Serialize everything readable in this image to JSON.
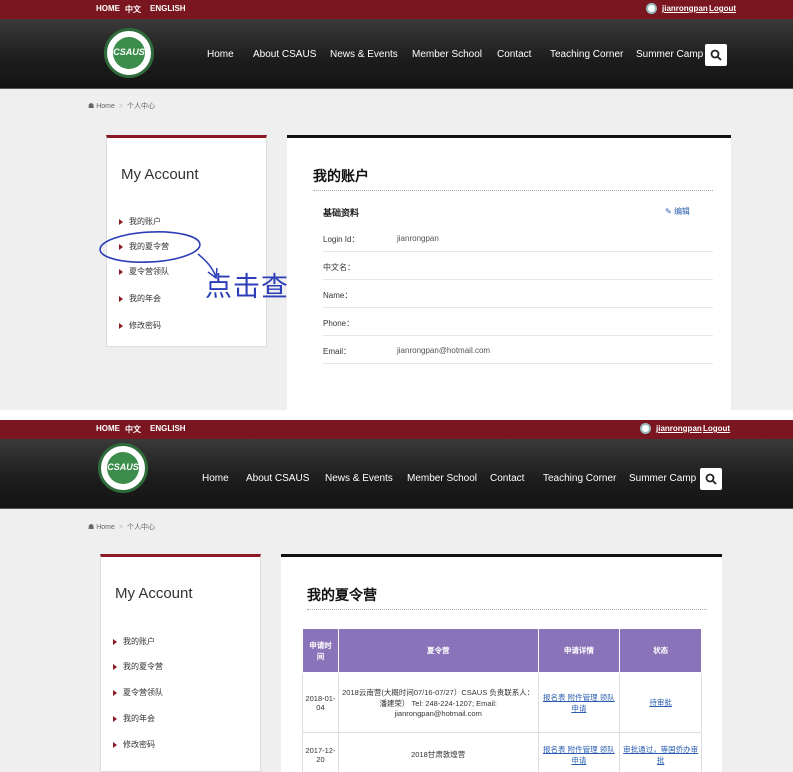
{
  "topbar": {
    "lang_home": "HOME",
    "lang_zh": "中文",
    "lang_en": "ENGLISH",
    "username": "jianrongpan",
    "logout": "Logout"
  },
  "logo": {
    "text": "CSAUS"
  },
  "nav": [
    "Home",
    "About CSAUS",
    "News & Events",
    "Member School",
    "Contact",
    "Teaching Corner",
    "Summer Camp"
  ],
  "breadcrumb": {
    "home": "Home",
    "current": "个人中心"
  },
  "sidebar": {
    "title": "My Account",
    "items": [
      "我的账户",
      "我的夏令营",
      "夏令营领队",
      "我的年会",
      "修改密码"
    ]
  },
  "account": {
    "title": "我的账户",
    "section": "基础资料",
    "edit": "编辑",
    "fields": [
      {
        "label": "Login Id：",
        "value": "jianrongpan"
      },
      {
        "label": "中文名：",
        "value": ""
      },
      {
        "label": "Name：",
        "value": ""
      },
      {
        "label": "Phone：",
        "value": ""
      },
      {
        "label": "Email：",
        "value": "jianrongpan@hotmail.com"
      }
    ]
  },
  "annotation": {
    "text": "点击查看"
  },
  "camp": {
    "title": "我的夏令营",
    "headers": [
      "申请时间",
      "夏令营",
      "申请详情",
      "状态"
    ],
    "rows": [
      {
        "date": "2018-01-04",
        "camp": "2018云南营(大概时间07/16-07/27）CSAUS 负责联系人：潘建荣） Tel: 248-224-1207; Email: jianrongpan@hotmail.com",
        "detail": "报名表 附件管理 领队申请",
        "status": "待审批"
      },
      {
        "date": "2017-12-20",
        "camp": "2018甘肃敦煌营",
        "detail": "报名表 附件管理 领队申请",
        "status": "审批通过，等国侨办审批"
      }
    ]
  },
  "colors": {
    "topbar": "#7a1620",
    "accent": "#8b1a22",
    "table_header": "#8b73b9",
    "link": "#2a5db0"
  }
}
